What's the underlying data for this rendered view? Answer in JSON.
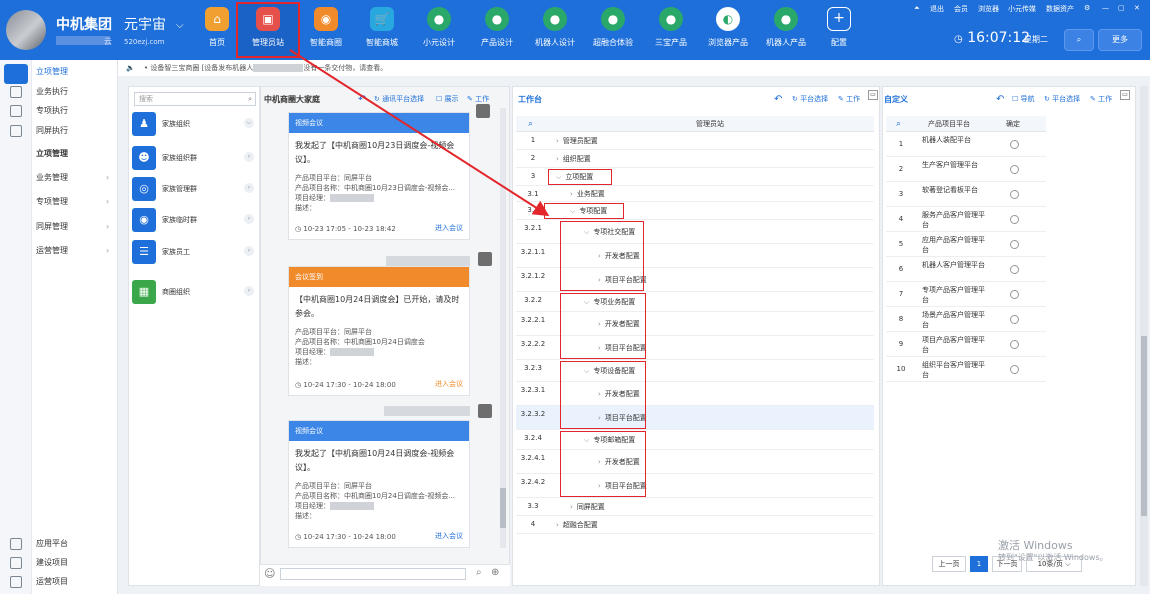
{
  "header": {
    "brand": "中机集团",
    "brand_suffix": "云",
    "platform": "元宇宙",
    "platform_chevron": "⌵",
    "site": "520ezj.com",
    "nav": [
      {
        "label": "首页",
        "color": "#f0a030",
        "glyph": "⌂"
      },
      {
        "label": "管理员站",
        "color": "#e6504a",
        "glyph": "▣"
      },
      {
        "label": "智能商圈",
        "color": "#f08a2a",
        "glyph": "◉"
      },
      {
        "label": "智能商城",
        "color": "#29a8e0",
        "glyph": "🛒"
      },
      {
        "label": "小元设计",
        "color": "#2aa86a",
        "glyph": "●"
      },
      {
        "label": "产品设计",
        "color": "#2aa86a",
        "glyph": "●"
      },
      {
        "label": "机器人设计",
        "color": "#2aa86a",
        "glyph": "●"
      },
      {
        "label": "超融合体验",
        "color": "#2aa86a",
        "glyph": "●"
      },
      {
        "label": "三宝产品",
        "color": "#2aa86a",
        "glyph": "●"
      },
      {
        "label": "浏览器产品",
        "color": "#ffffff",
        "glyph": "◐"
      },
      {
        "label": "机器人产品",
        "color": "#2aa86a",
        "glyph": "●"
      },
      {
        "label": "配置",
        "color": "#1e6fd9",
        "glyph": "+"
      }
    ],
    "top_links": [
      "退出",
      "会员",
      "浏览器",
      "小元传媒",
      "数据资产"
    ],
    "clock_icon": "◷",
    "time": "16:07:12",
    "weekday": "星期二",
    "search_glyph": "⌕",
    "more_label": "更多"
  },
  "sidebar": {
    "top_items": [
      {
        "label": "立项管理",
        "active": true
      },
      {
        "label": "业务执行"
      },
      {
        "label": "专项执行"
      },
      {
        "label": "同屏执行"
      }
    ],
    "section_title": "立项管理",
    "menu": [
      "业务管理",
      "专项管理",
      "同屏管理",
      "运营管理"
    ],
    "bottom_items": [
      "应用平台",
      "建设项目",
      "运营项目"
    ]
  },
  "notice": {
    "icon": "🔈",
    "text": "• 设备智三宝商圈 [设备发布机器人",
    "text_tail": "没有一条交付物，请查看。"
  },
  "org_panel": {
    "search_placeholder": "搜索",
    "search_glyph": "⌕",
    "items": [
      {
        "label": "家族组织",
        "color": "#1e6fd9",
        "glyph": "♟"
      },
      {
        "label": "家族组织群",
        "color": "#1e6fd9",
        "glyph": "☻"
      },
      {
        "label": "家族管理群",
        "color": "#1e6fd9",
        "glyph": "◎"
      },
      {
        "label": "家族临时群",
        "color": "#1e6fd9",
        "glyph": "◉"
      },
      {
        "label": "家族员工",
        "color": "#1e6fd9",
        "glyph": "☰"
      },
      {
        "label": "商圈组织",
        "color": "#3aa84a",
        "glyph": "▦"
      }
    ]
  },
  "chat_panel": {
    "title": "中机商圈大家庭",
    "actions": [
      "通讯平台选择",
      "展示",
      "工作"
    ],
    "cards": [
      {
        "header": "视频会议",
        "header_color": "#3b86e6",
        "body": "我发起了【中机商圈10月23日调度会-视频会议】。",
        "meta": [
          "产品项目平台：同屏平台",
          "产品项目名称：中机商圈10月23日调度会-视频会...",
          "项目经理：",
          "描述："
        ],
        "time": "10-23 17:05 - 10-23 18:42",
        "join": "进入会议",
        "join_color": "#1e6fd9"
      },
      {
        "header": "会议签到",
        "header_color": "#f08a2a",
        "body": "【中机商圈10月24日调度会】已开始，请及时参会。",
        "meta": [
          "产品项目平台：同屏平台",
          "产品项目名称：中机商圈10月24日调度会",
          "项目经理：",
          "描述："
        ],
        "time": "10-24 17:30 - 10-24 18:00",
        "join": "进入会议",
        "join_color": "#f08a2a"
      },
      {
        "header": "视频会议",
        "header_color": "#3b86e6",
        "body": "我发起了【中机商圈10月24日调度会-视频会议】。",
        "meta": [
          "产品项目平台：同屏平台",
          "产品项目名称：中机商圈10月24日调度会-视频会...",
          "项目经理：",
          "描述："
        ],
        "time": "10-24 17:30 - 10-24 18:00",
        "join": "进入会议",
        "join_color": "#1e6fd9"
      }
    ],
    "emoji_glyph": "☺",
    "search_glyph": "⌕",
    "add_glyph": "⊕"
  },
  "workbench": {
    "title": "工作台",
    "actions": [
      "平台选择",
      "工作"
    ],
    "column_header": "管理员站",
    "rows": [
      {
        "num": "1",
        "label": "管理员配置",
        "indent": 0
      },
      {
        "num": "2",
        "label": "组织配置",
        "indent": 0
      },
      {
        "num": "3",
        "label": "立项配置",
        "indent": 0,
        "open": true
      },
      {
        "num": "3.1",
        "label": "业务配置",
        "indent": 1
      },
      {
        "num": "3.2",
        "label": "专项配置",
        "indent": 1,
        "open": true
      },
      {
        "num": "3.2.1",
        "label": "专项社交配置",
        "indent": 2,
        "open": true
      },
      {
        "num": "3.2.1.1",
        "label": "开发者配置",
        "indent": 3
      },
      {
        "num": "3.2.1.2",
        "label": "项目平台配置",
        "indent": 3
      },
      {
        "num": "3.2.2",
        "label": "专项业务配置",
        "indent": 2,
        "open": true
      },
      {
        "num": "3.2.2.1",
        "label": "开发者配置",
        "indent": 3
      },
      {
        "num": "3.2.2.2",
        "label": "项目平台配置",
        "indent": 3
      },
      {
        "num": "3.2.3",
        "label": "专项设备配置",
        "indent": 2,
        "open": true
      },
      {
        "num": "3.2.3.1",
        "label": "开发者配置",
        "indent": 3
      },
      {
        "num": "3.2.3.2",
        "label": "项目平台配置",
        "indent": 3,
        "highlight": true
      },
      {
        "num": "3.2.4",
        "label": "专项邮箱配置",
        "indent": 2,
        "open": true
      },
      {
        "num": "3.2.4.1",
        "label": "开发者配置",
        "indent": 3
      },
      {
        "num": "3.2.4.2",
        "label": "项目平台配置",
        "indent": 3
      },
      {
        "num": "3.3",
        "label": "同屏配置",
        "indent": 1
      },
      {
        "num": "4",
        "label": "超融合配置",
        "indent": 0
      }
    ],
    "row_colors": {
      "highlight": "#e9f2fd",
      "annotation": "#e3262b"
    }
  },
  "custom": {
    "title": "自定义",
    "actions": [
      "导航",
      "平台选择",
      "工作"
    ],
    "headers": [
      "产品项目平台",
      "确定"
    ],
    "search_glyph": "⌕",
    "rows": [
      {
        "num": "1",
        "label": "机器人装配平台"
      },
      {
        "num": "2",
        "label": "生产客户管理平台"
      },
      {
        "num": "3",
        "label": "软著登记看板平台"
      },
      {
        "num": "4",
        "label": "服务产品客户管理平台"
      },
      {
        "num": "5",
        "label": "应用产品客户管理平台"
      },
      {
        "num": "6",
        "label": "机器人客户管理平台"
      },
      {
        "num": "7",
        "label": "专项产品客户管理平台"
      },
      {
        "num": "8",
        "label": "场景产品客户管理平台"
      },
      {
        "num": "9",
        "label": "项目产品客户管理平台"
      },
      {
        "num": "10",
        "label": "组织平台客户管理平台"
      }
    ],
    "pager": {
      "prev": "上一页",
      "page": "1",
      "next": "下一页",
      "size": "10条/页"
    }
  },
  "watermark": {
    "line1": "激活 Windows",
    "line2": "转到\"设置\"以激活 Windows。"
  }
}
